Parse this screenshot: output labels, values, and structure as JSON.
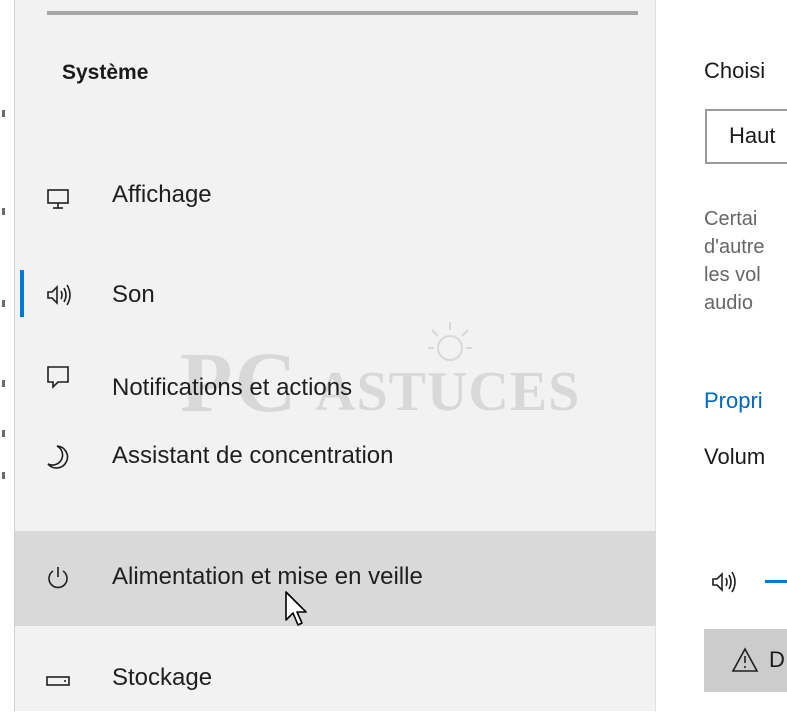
{
  "sidebar": {
    "title": "Système",
    "items": [
      {
        "label": "Affichage",
        "icon": "monitor-icon",
        "selected": false,
        "hovered": false
      },
      {
        "label": "Son",
        "icon": "speaker-icon",
        "selected": true,
        "hovered": false
      },
      {
        "label": "Notifications et actions",
        "icon": "notification-icon",
        "selected": false,
        "hovered": false
      },
      {
        "label": "Assistant de concentration",
        "icon": "moon-icon",
        "selected": false,
        "hovered": false
      },
      {
        "label": "Alimentation et mise en veille",
        "icon": "power-icon",
        "selected": false,
        "hovered": true
      },
      {
        "label": "Stockage",
        "icon": "storage-icon",
        "selected": false,
        "hovered": false
      }
    ]
  },
  "main": {
    "heading_partial": "Choisi",
    "device_select_value": "Haut",
    "description_lines": [
      "Certai",
      "d'autre",
      "les vol",
      "audio"
    ],
    "properties_link": "Propri",
    "volume_heading": "Volum",
    "troubleshoot_button_label": "D"
  },
  "watermark": {
    "pc": "PC",
    "astuces": "ASTUCES"
  },
  "colors": {
    "accent": "#0078d7",
    "sidebar_bg": "#f2f2f2",
    "hover_bg": "#d9d9d9",
    "link": "#0067c0"
  }
}
